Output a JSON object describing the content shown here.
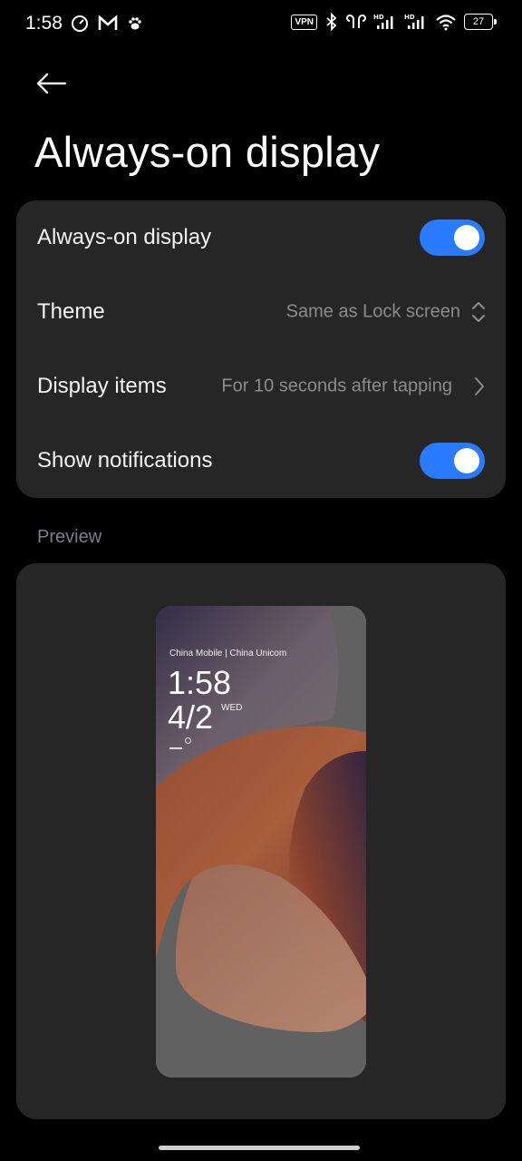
{
  "status_bar": {
    "time": "1:58",
    "vpn": "VPN",
    "battery": "27",
    "left_icons": [
      "speedometer-icon",
      "gmail-icon",
      "paw-icon"
    ],
    "right_icons": [
      "vpn-icon",
      "bluetooth-icon",
      "earbuds-icon",
      "hd-signal-icon",
      "hd-signal-icon",
      "wifi-icon",
      "battery-icon"
    ]
  },
  "header": {
    "back_icon": "back-arrow-icon",
    "title": "Always-on display"
  },
  "settings": {
    "always_on": {
      "label": "Always-on display",
      "enabled": true
    },
    "theme": {
      "label": "Theme",
      "value": "Same as Lock screen",
      "icon": "chevron-up-down-icon"
    },
    "display_items": {
      "label": "Display items",
      "value": "For 10 seconds after tapping",
      "icon": "chevron-right-icon"
    },
    "show_notifications": {
      "label": "Show notifications",
      "enabled": true
    }
  },
  "preview": {
    "section_label": "Preview",
    "carrier": "China Mobile | China Unicom",
    "time": "1:58",
    "date": "4/2",
    "weekday": "WED"
  },
  "colors": {
    "accent": "#2a7bff",
    "card_bg": "#262626",
    "background": "#000000"
  }
}
